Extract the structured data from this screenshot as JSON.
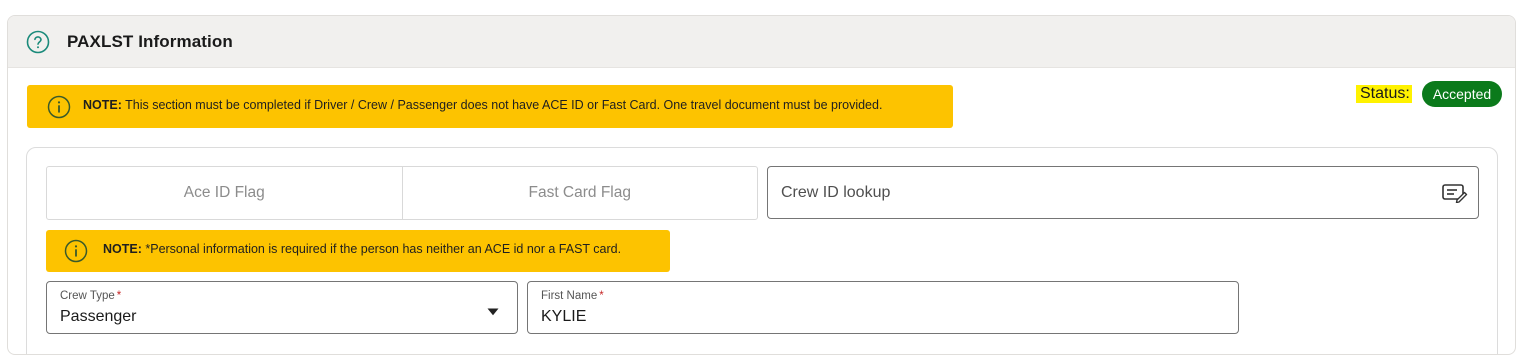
{
  "section": {
    "title": "PAXLST Information",
    "help_icon": "question-circle-icon"
  },
  "note_main": {
    "icon": "info-circle-icon",
    "prefix": "NOTE:",
    "text": " This section must be completed if Driver / Crew / Passenger does not have ACE ID or Fast Card. One travel document must be provided."
  },
  "status": {
    "label": "Status:",
    "value": "Accepted",
    "badge_color": "#0b7a1b",
    "highlight_color": "#fff200"
  },
  "flags": {
    "ace_id_label": "Ace ID Flag",
    "fast_card_label": "Fast Card Flag"
  },
  "crew_lookup": {
    "placeholder": "Crew ID lookup",
    "value": "",
    "icon": "edit-note-icon"
  },
  "note_personal": {
    "icon": "info-circle-icon",
    "prefix": "NOTE:",
    "text": " *Personal information is required if the person has neither an ACE id nor a FAST card."
  },
  "form": {
    "crew_type": {
      "label": "Crew Type",
      "required_mark": "*",
      "value": "Passenger",
      "icon": "caret-down-icon"
    },
    "first_name": {
      "label": "First Name",
      "required_mark": "*",
      "value": "KYLIE"
    }
  },
  "colors": {
    "note_bg": "#fdc300",
    "header_bg": "#f1f0ee",
    "help_icon": "#1a8a7a"
  }
}
